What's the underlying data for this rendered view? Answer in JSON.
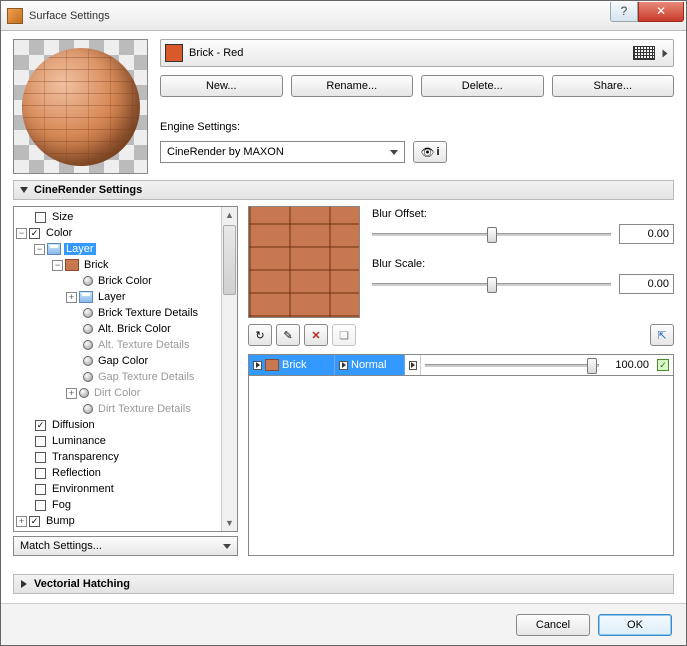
{
  "window": {
    "title": "Surface Settings"
  },
  "material": {
    "name": "Brick - Red",
    "swatch_color": "#d85a2a"
  },
  "buttons": {
    "new": "New...",
    "rename": "Rename...",
    "delete": "Delete...",
    "share": "Share..."
  },
  "engine": {
    "label": "Engine Settings:",
    "selected": "CineRender by MAXON"
  },
  "sections": {
    "cinerender": "CineRender Settings",
    "vectorial": "Vectorial Hatching"
  },
  "tree": {
    "size": "Size",
    "color": "Color",
    "layer": "Layer",
    "brick": "Brick",
    "brick_color": "Brick Color",
    "layer2": "Layer",
    "brick_tex": "Brick Texture Details",
    "alt_brick": "Alt. Brick Color",
    "alt_tex": "Alt. Texture Details",
    "gap_color": "Gap Color",
    "gap_tex": "Gap Texture Details",
    "dirt_color": "Dirt Color",
    "dirt_tex": "Dirt Texture Details",
    "diffusion": "Diffusion",
    "luminance": "Luminance",
    "transparency": "Transparency",
    "reflection": "Reflection",
    "environment": "Environment",
    "fog": "Fog",
    "bump": "Bump"
  },
  "match": "Match Settings...",
  "blur": {
    "offset_label": "Blur Offset:",
    "offset_value": "0.00",
    "scale_label": "Blur Scale:",
    "scale_value": "0.00"
  },
  "layer_row": {
    "name": "Brick",
    "mode": "Normal",
    "opacity": "100.00"
  },
  "dialog": {
    "cancel": "Cancel",
    "ok": "OK"
  }
}
